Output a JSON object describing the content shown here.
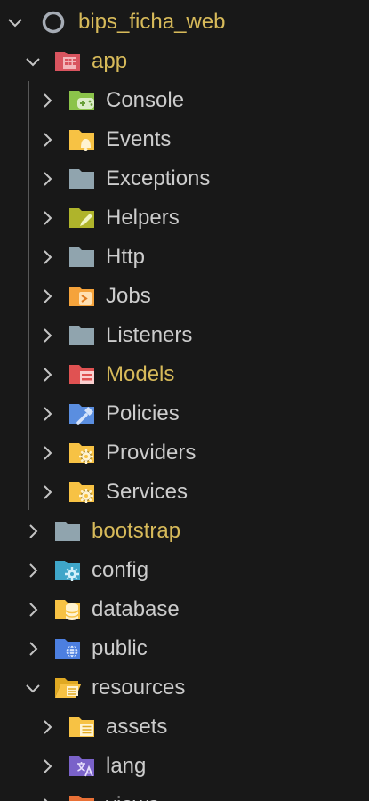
{
  "colors": {
    "background": "#181818",
    "text_default": "#cccccc",
    "text_git_modified": "#d7ba5a",
    "chevron": "#c5c5c5",
    "indent_guide": "#585858"
  },
  "tree": [
    {
      "label": "bips_ficha_web",
      "expanded": true,
      "icon": "repo-circle-icon",
      "label_color": "#d7ba5a"
    },
    {
      "label": "app",
      "expanded": true,
      "icon": "app-folder-icon",
      "label_color": "#d7ba5a"
    },
    {
      "label": "Console",
      "expanded": false,
      "icon": "console-folder-icon",
      "label_color": "#cccccc"
    },
    {
      "label": "Events",
      "expanded": false,
      "icon": "events-folder-icon",
      "label_color": "#cccccc"
    },
    {
      "label": "Exceptions",
      "expanded": false,
      "icon": "folder-icon",
      "label_color": "#cccccc"
    },
    {
      "label": "Helpers",
      "expanded": false,
      "icon": "helpers-folder-icon",
      "label_color": "#cccccc"
    },
    {
      "label": "Http",
      "expanded": false,
      "icon": "folder-icon",
      "label_color": "#cccccc"
    },
    {
      "label": "Jobs",
      "expanded": false,
      "icon": "jobs-folder-icon",
      "label_color": "#cccccc"
    },
    {
      "label": "Listeners",
      "expanded": false,
      "icon": "folder-icon",
      "label_color": "#cccccc"
    },
    {
      "label": "Models",
      "expanded": false,
      "icon": "models-folder-icon",
      "label_color": "#d7ba5a"
    },
    {
      "label": "Policies",
      "expanded": false,
      "icon": "policies-folder-icon",
      "label_color": "#cccccc"
    },
    {
      "label": "Providers",
      "expanded": false,
      "icon": "providers-folder-icon",
      "label_color": "#cccccc"
    },
    {
      "label": "Services",
      "expanded": false,
      "icon": "services-folder-icon",
      "label_color": "#cccccc"
    },
    {
      "label": "bootstrap",
      "expanded": false,
      "icon": "folder-icon",
      "label_color": "#d7ba5a"
    },
    {
      "label": "config",
      "expanded": false,
      "icon": "config-folder-icon",
      "label_color": "#cccccc"
    },
    {
      "label": "database",
      "expanded": false,
      "icon": "database-folder-icon",
      "label_color": "#cccccc"
    },
    {
      "label": "public",
      "expanded": false,
      "icon": "public-folder-icon",
      "label_color": "#cccccc"
    },
    {
      "label": "resources",
      "expanded": true,
      "icon": "resources-folder-open-icon",
      "label_color": "#cccccc"
    },
    {
      "label": "assets",
      "expanded": false,
      "icon": "assets-folder-icon",
      "label_color": "#cccccc"
    },
    {
      "label": "lang",
      "expanded": false,
      "icon": "lang-folder-icon",
      "label_color": "#cccccc"
    },
    {
      "label": "views",
      "expanded": false,
      "icon": "views-folder-icon",
      "label_color": "#cccccc"
    }
  ]
}
